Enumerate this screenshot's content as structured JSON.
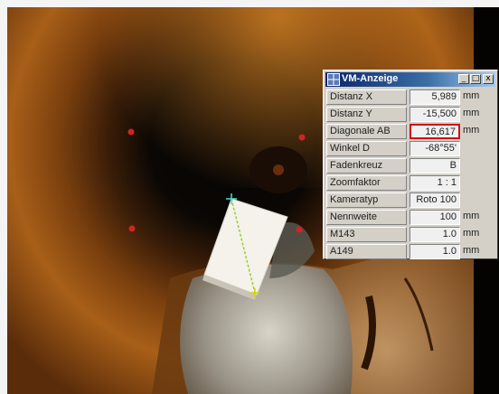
{
  "window": {
    "title": "VM-Anzeige",
    "buttons": {
      "minimize": "_",
      "maximize": "□",
      "close": "x"
    }
  },
  "rows": [
    {
      "label": "Distanz X",
      "value": "5,989",
      "unit": "mm"
    },
    {
      "label": "Distanz Y",
      "value": "-15,500",
      "unit": "mm"
    },
    {
      "label": "Diagonale AB",
      "value": "16,617",
      "unit": "mm",
      "highlight": true
    },
    {
      "label": "Winkel D",
      "value": "-68°55'",
      "unit": ""
    },
    {
      "label": "Fadenkreuz",
      "value": "B",
      "unit": ""
    },
    {
      "label": "Zoomfaktor",
      "value": "1 : 1",
      "unit": ""
    },
    {
      "label": "Kameratyp",
      "value": "Roto 100",
      "unit": ""
    },
    {
      "label": "Nennweite",
      "value": "100",
      "unit": "mm"
    },
    {
      "label": "M143",
      "value": "1.0",
      "unit": "mm"
    },
    {
      "label": "A149",
      "value": "1.0",
      "unit": "mm"
    }
  ],
  "colors": {
    "highlight_border": "#d01010",
    "title_bar": "#0a246a",
    "marker_dots": "#d42222",
    "measure_line": "#9acd32",
    "crosshair": "#40e0d0"
  },
  "icons": [
    "grid-icon",
    "minimize-icon",
    "maximize-icon",
    "close-icon"
  ]
}
